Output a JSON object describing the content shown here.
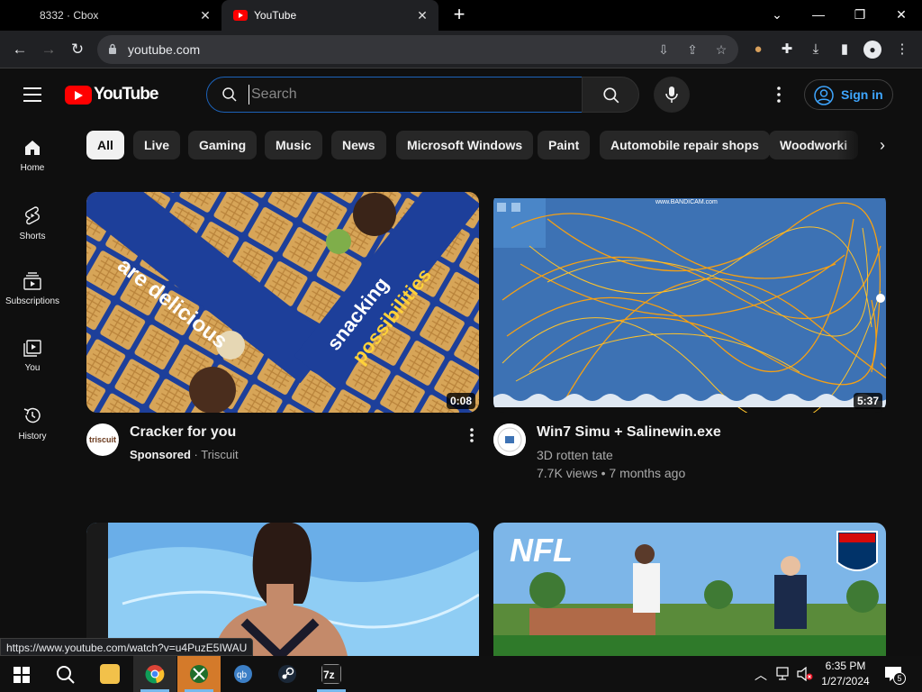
{
  "browser": {
    "tabs": [
      {
        "title": "8332 · Cbox"
      },
      {
        "title": "YouTube"
      }
    ],
    "address": "youtube.com",
    "status_url": "https://www.youtube.com/watch?v=u4PuzE5IWAU"
  },
  "youtube": {
    "logo_text": "YouTube",
    "search_placeholder": "Search",
    "signin_label": "Sign in",
    "guide": [
      {
        "label": "Home",
        "icon": "home-icon"
      },
      {
        "label": "Shorts",
        "icon": "shorts-icon"
      },
      {
        "label": "Subscriptions",
        "icon": "subscriptions-icon"
      },
      {
        "label": "You",
        "icon": "you-icon"
      },
      {
        "label": "History",
        "icon": "history-icon"
      }
    ],
    "chips": [
      {
        "label": "All",
        "active": true
      },
      {
        "label": "Live"
      },
      {
        "label": "Gaming"
      },
      {
        "label": "Music"
      },
      {
        "label": "News"
      },
      {
        "label": "Microsoft Windows"
      },
      {
        "label": "Paint"
      },
      {
        "label": "Automobile repair shops"
      },
      {
        "label": "Woodworki"
      }
    ],
    "videos": [
      {
        "title": "Cracker for you",
        "sponsored_label": "Sponsored",
        "channel": "Triscuit",
        "duration": "0:08",
        "avatar_text": "triscuit",
        "thumb_text_1": "are delicious",
        "thumb_text_2": "snacking",
        "thumb_text_3": "possibilities"
      },
      {
        "title": "Win7 Simu + Salinewin.exe",
        "channel": "3D rotten tate",
        "views": "7.7K views",
        "age": "7 months ago",
        "duration": "5:37",
        "thumb_watermark": "www.BANDICAM.com"
      },
      {
        "title": ""
      },
      {
        "title": "",
        "thumb_text": "NFL"
      }
    ]
  },
  "taskbar": {
    "time": "6:35 PM",
    "date": "1/27/2024",
    "notification_count": "5",
    "apps": [
      "start-icon",
      "search-icon",
      "file-explorer-icon",
      "chrome-icon",
      "xbox-icon",
      "qbittorrent-icon",
      "steam-icon",
      "7zip-icon"
    ]
  },
  "colors": {
    "yt_red": "#ff0000",
    "link_blue": "#3ea6ff",
    "background": "#0f0f0f"
  }
}
